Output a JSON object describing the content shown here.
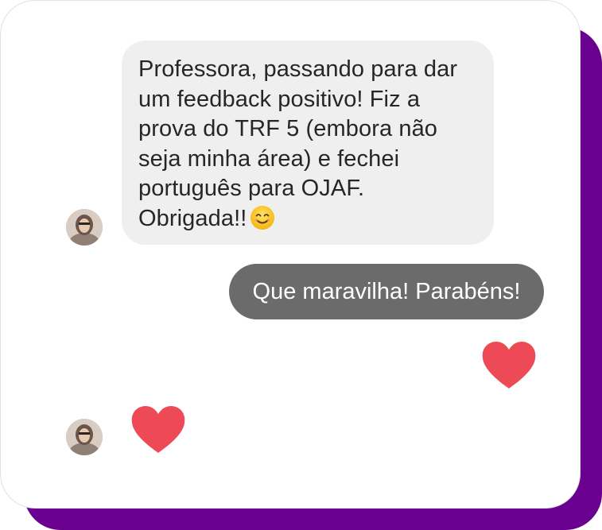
{
  "conversation": {
    "incoming": {
      "lines": [
        "Professora, passando para dar",
        "um feedback positivo! Fiz a",
        "prova do TRF 5 (embora não",
        "seja minha área) e fechei",
        "português para OJAF.",
        "Obrigada!!"
      ],
      "emoji": "smiling-face-icon"
    },
    "outgoing": {
      "text": "Que maravilha! Parabéns!"
    },
    "reactions": {
      "outgoing_heart": "heart-icon",
      "incoming_heart": "heart-icon"
    }
  },
  "colors": {
    "frame_accent": "#690090",
    "incoming_bubble": "#efefef",
    "outgoing_bubble": "#6b6b6b",
    "heart": "#ed4956"
  }
}
